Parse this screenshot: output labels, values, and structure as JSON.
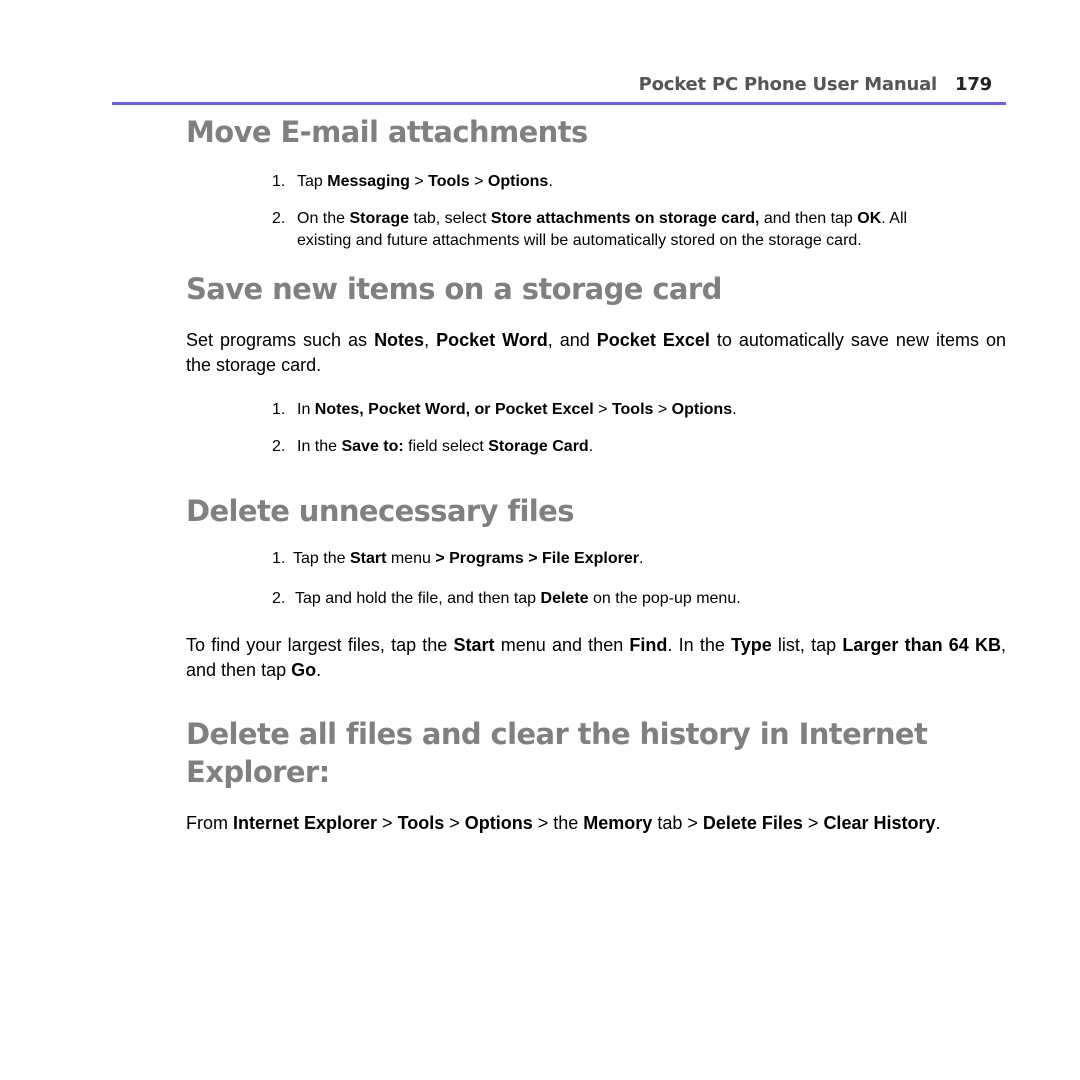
{
  "header": {
    "title": "Pocket PC Phone User Manual",
    "page_number": "179",
    "rule_color": "#6b5ff0"
  },
  "sections": [
    {
      "heading": "Move E-mail attachments",
      "steps": [
        {
          "num": "1.",
          "parts": [
            "Tap ",
            "Messaging",
            " > ",
            "Tools",
            " > ",
            "Options",
            "."
          ]
        },
        {
          "num": "2.",
          "parts": [
            "On the ",
            "Storage",
            " tab, select ",
            "Store attachments on storage card,",
            " and then tap ",
            "OK",
            ". All"
          ],
          "continuation": "existing and future attachments will be automatically stored on the storage card."
        }
      ]
    },
    {
      "heading": "Save new items on a storage card",
      "intro": [
        "Set programs such as ",
        "Notes",
        ", ",
        "Pocket Word",
        ", and ",
        "Pocket Excel",
        " to automatically save new items on the storage card."
      ],
      "steps": [
        {
          "num": "1.",
          "parts": [
            "In ",
            "Notes, Pocket Word, or Pocket Excel",
            " > ",
            "Tools",
            " > ",
            "Options",
            "."
          ]
        },
        {
          "num": "2.",
          "parts": [
            "In the ",
            "Save to:",
            " field select ",
            "Storage Card",
            "."
          ]
        }
      ]
    },
    {
      "heading": "Delete unnecessary files",
      "steps": [
        {
          "num": "1.",
          "parts": [
            "Tap the ",
            "Start",
            " menu ",
            "> Programs > File Explorer",
            "."
          ]
        },
        {
          "num": "2.",
          "parts": [
            "Tap and hold the file, and then tap ",
            "Delete",
            " on the pop-up menu."
          ]
        }
      ],
      "outro": [
        "To find your largest files, tap the ",
        "Start",
        " menu and then ",
        "Find",
        ". In the ",
        "Type",
        " list, tap ",
        "Larger than 64 KB",
        ", and then tap ",
        "Go",
        "."
      ]
    },
    {
      "heading": "Delete all files and clear the history in Internet Explorer:",
      "intro": [
        "From ",
        "Internet Explorer",
        " > ",
        "Tools",
        " > ",
        "Options",
        " > the ",
        "Memory",
        " tab > ",
        "Delete Files",
        " > ",
        "Clear History",
        "."
      ]
    }
  ]
}
